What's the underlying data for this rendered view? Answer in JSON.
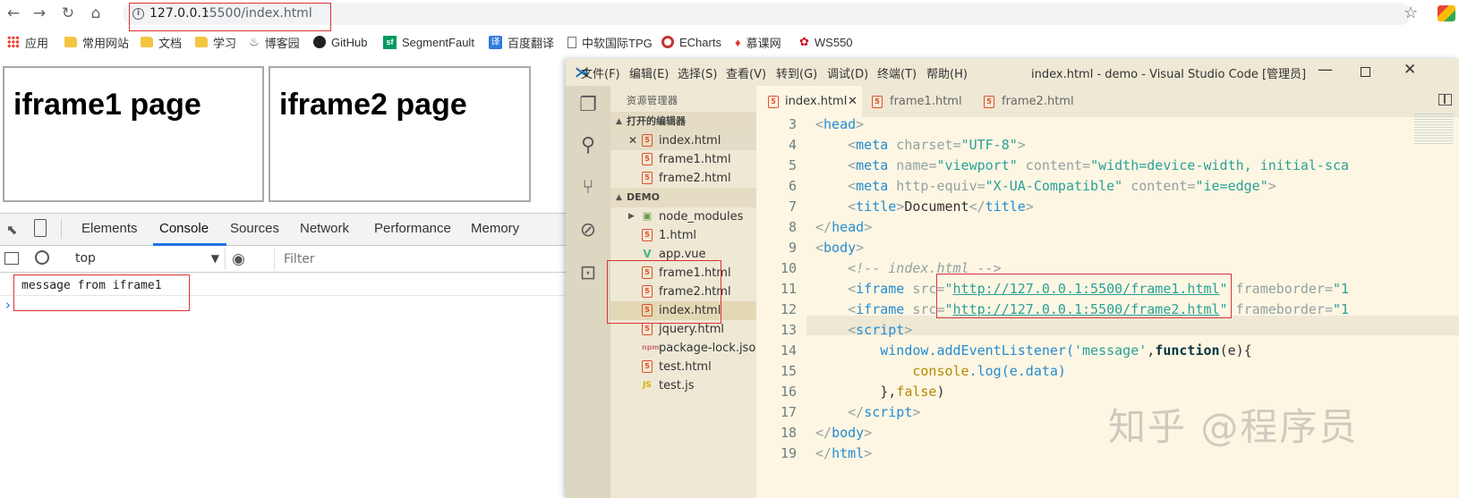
{
  "browser": {
    "url_host": "127.0.0.1",
    "url_path": ":5500/index.html",
    "bookmarks": [
      {
        "label": "应用",
        "icon": "apps-grid-icon"
      },
      {
        "label": "常用网站",
        "icon": "folder-icon"
      },
      {
        "label": "文档",
        "icon": "folder-icon"
      },
      {
        "label": "学习",
        "icon": "folder-icon"
      },
      {
        "label": "博客园",
        "icon": "cnblogs-icon"
      },
      {
        "label": "GitHub",
        "icon": "github-icon"
      },
      {
        "label": "SegmentFault",
        "icon": "segmentfault-icon"
      },
      {
        "label": "百度翻译",
        "icon": "baidu-translate-icon"
      },
      {
        "label": "中软国际TPG",
        "icon": "page-icon"
      },
      {
        "label": "ECharts",
        "icon": "echarts-icon"
      },
      {
        "label": "慕课网",
        "icon": "imooc-icon"
      },
      {
        "label": "WS550",
        "icon": "huawei-icon"
      }
    ]
  },
  "page": {
    "iframe1_heading": "iframe1 page",
    "iframe2_heading": "iframe2 page"
  },
  "devtools": {
    "tabs": [
      "Elements",
      "Console",
      "Sources",
      "Network",
      "Performance",
      "Memory"
    ],
    "active_tab": "Console",
    "context": "top",
    "filter_placeholder": "Filter",
    "console_message": "message from iframe1"
  },
  "vscode": {
    "menu": [
      "文件(F)",
      "编辑(E)",
      "选择(S)",
      "查看(V)",
      "转到(G)",
      "调试(D)",
      "终端(T)",
      "帮助(H)"
    ],
    "window_title": "index.html - demo - Visual Studio Code [管理员]",
    "sidebar_title": "资源管理器",
    "open_editors_header": "打开的编辑器",
    "open_editors": [
      "index.html",
      "frame1.html",
      "frame2.html"
    ],
    "folder_header": "DEMO",
    "files": [
      {
        "name": "node_modules",
        "type": "folder"
      },
      {
        "name": "1.html",
        "type": "html"
      },
      {
        "name": "app.vue",
        "type": "vue"
      },
      {
        "name": "frame1.html",
        "type": "html"
      },
      {
        "name": "frame2.html",
        "type": "html"
      },
      {
        "name": "index.html",
        "type": "html"
      },
      {
        "name": "jquery.html",
        "type": "html"
      },
      {
        "name": "package-lock.json",
        "type": "json"
      },
      {
        "name": "test.html",
        "type": "html"
      },
      {
        "name": "test.js",
        "type": "js"
      }
    ],
    "tabs": [
      "index.html",
      "frame1.html",
      "frame2.html"
    ],
    "active_tab": "index.html",
    "line_numbers": [
      "3",
      "4",
      "5",
      "6",
      "7",
      "8",
      "9",
      "10",
      "11",
      "12",
      "13",
      "14",
      "15",
      "16",
      "17",
      "18",
      "19"
    ],
    "code": {
      "l3": [
        "<",
        "head",
        ">"
      ],
      "l4": [
        "<",
        "meta",
        " charset",
        "=",
        "\"UTF-8\"",
        ">"
      ],
      "l5": [
        "<",
        "meta",
        " name",
        "=",
        "\"viewport\"",
        " content",
        "=",
        "\"width=device-width, initial-sca"
      ],
      "l6": [
        "<",
        "meta",
        " http-equiv",
        "=",
        "\"X-UA-Compatible\"",
        " content",
        "=",
        "\"ie=edge\"",
        ">"
      ],
      "l7": [
        "<",
        "title",
        ">",
        "Document",
        "</",
        "title",
        ">"
      ],
      "l8": [
        "</",
        "head",
        ">"
      ],
      "l9": [
        "<",
        "body",
        ">"
      ],
      "l10": "<!-- index.html -->",
      "l11": [
        "<",
        "iframe",
        " src",
        "=",
        "\"",
        "http://127.0.0.1:5500/frame1.html",
        "\"",
        " frameborder",
        "=",
        "\"1"
      ],
      "l12": [
        "<",
        "iframe",
        " src",
        "=",
        "\"",
        "http://127.0.0.1:5500/frame2.html",
        "\"",
        " frameborder",
        "=",
        "\"1"
      ],
      "l13": [
        "<",
        "script",
        ">"
      ],
      "l14": [
        "window",
        ".addEventListener(",
        "'message'",
        ",",
        "function",
        "(e){"
      ],
      "l15": [
        "console",
        ".log(e.data)"
      ],
      "l16": [
        "},",
        "false",
        ")"
      ],
      "l17": [
        "</",
        "script",
        ">"
      ],
      "l18": [
        "</",
        "body",
        ">"
      ],
      "l19": [
        "</",
        "html",
        ">"
      ]
    },
    "watermark": "知乎 @程序员"
  }
}
